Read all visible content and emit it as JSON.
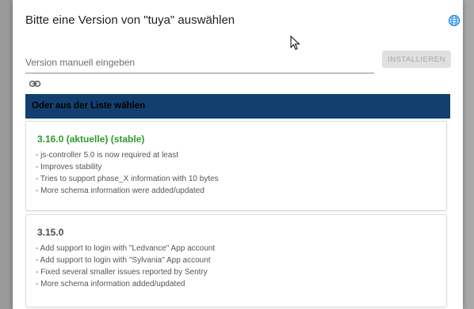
{
  "dialog": {
    "title": "Bitte eine Version von \"tuya\" auswählen",
    "version_input_placeholder": "Version manuell eingeben",
    "install_label": "INSTALLIEREN",
    "list_header": "Oder aus der Liste wählen"
  },
  "versions": [
    {
      "title": "3.16.0 (aktuelle) (stable)",
      "notes": [
        "- js-controller 5.0 is now required at least",
        "- Improves stability",
        "- Tries to support phase_X information with 10 bytes",
        "- More schema information were added/updated"
      ]
    },
    {
      "title": "3.15.0",
      "notes": [
        "- Add support to login with \"Ledvance\" App account",
        "- Add support to login with \"Sylvania\" App account",
        "- Fixed several smaller issues reported by Sentry",
        "- More schema information added/updated"
      ]
    }
  ],
  "colors": {
    "header_bg": "#123f6e",
    "current_version": "#2e9a2e",
    "globe_icon": "#1e88e5"
  }
}
